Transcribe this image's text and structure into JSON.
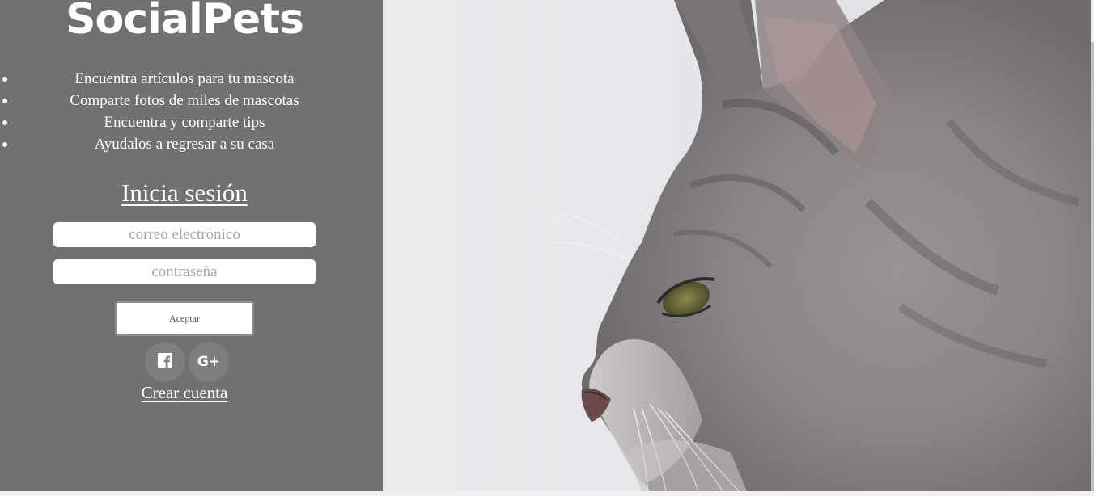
{
  "brand": {
    "name": "SocialPets"
  },
  "features": [
    "Encuentra artículos para tu mascota",
    "Comparte fotos de miles de mascotas",
    "Encuentra y comparte tips",
    "Ayudalos a regresar a su casa"
  ],
  "login": {
    "title": "Inicia sesión",
    "email_placeholder": "correo electrónico",
    "password_placeholder": "contraseña",
    "accept_label": "Aceptar",
    "create_account_label": "Crear cuenta"
  },
  "social": {
    "facebook_icon": "facebook-icon",
    "google_plus_icon": "google-plus-icon",
    "google_plus_glyph": "G+"
  },
  "hero": {
    "subject": "cat-profile-photo"
  },
  "colors": {
    "panel_bg": "#717073",
    "text": "#ffffff",
    "placeholder": "#a6a6a6",
    "social_bg": "#7e7d80"
  }
}
